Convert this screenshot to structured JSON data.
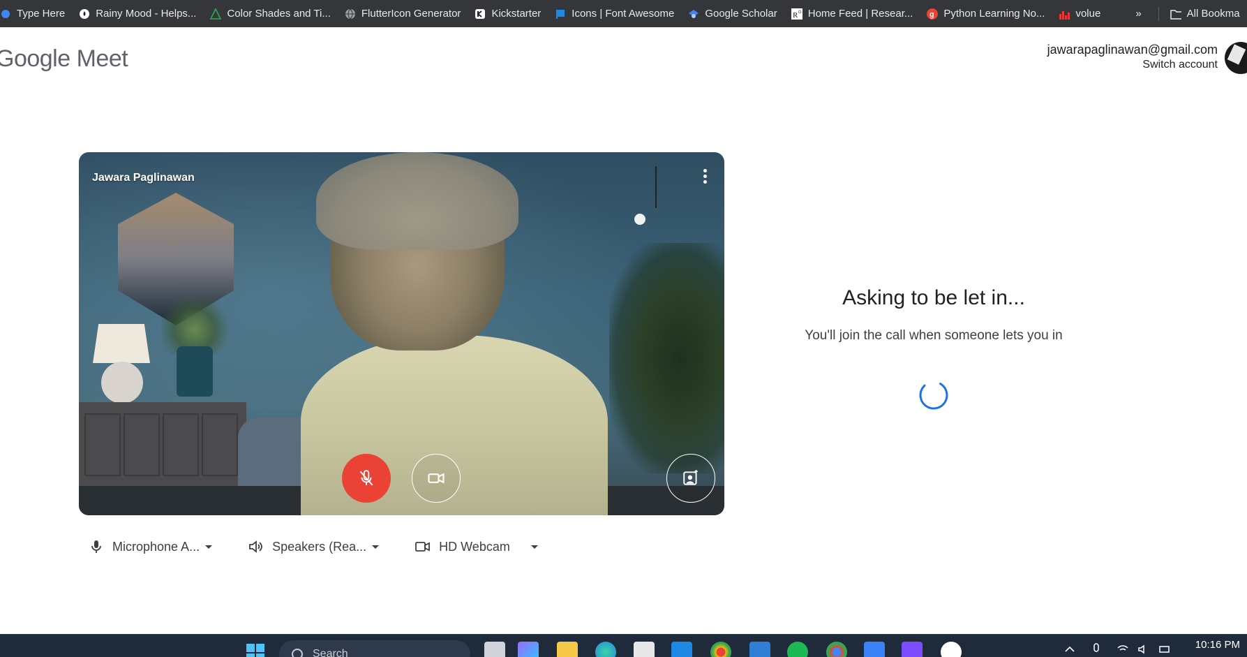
{
  "bookmarks": [
    {
      "label": "Type Here",
      "icon": "globe-icon",
      "color": "#4285f4"
    },
    {
      "label": "Rainy Mood - Helps...",
      "icon": "raindrop-icon",
      "color": "#ffffff"
    },
    {
      "label": "Color Shades and Ti...",
      "icon": "color-tint-icon",
      "color": "#34a853"
    },
    {
      "label": "FlutterIcon Generator",
      "icon": "globe-icon",
      "color": "#9aa0a6"
    },
    {
      "label": "Kickstarter",
      "icon": "kickstarter-icon",
      "color": "#ffffff"
    },
    {
      "label": "Icons | Font Awesome",
      "icon": "flag-icon",
      "color": "#1e88e5"
    },
    {
      "label": "Google Scholar",
      "icon": "scholar-icon",
      "color": "#4285f4"
    },
    {
      "label": "Home Feed | Resear...",
      "icon": "researchgate-icon",
      "color": "#ffffff"
    },
    {
      "label": "Python Learning No...",
      "icon": "g-icon",
      "color": "#ea4335"
    },
    {
      "label": "volue",
      "icon": "bar-chart-icon",
      "color": "#e53935"
    }
  ],
  "bookmarks_overflow": "»",
  "all_bookmarks": "All Bookma",
  "header": {
    "logo_google": "Google",
    "logo_meet": "Meet",
    "email": "jawarapaglinawan@gmail.com",
    "switch_account": "Switch account"
  },
  "video": {
    "participant_name": "Jawara Paglinawan"
  },
  "devices": {
    "microphone": "Microphone A...",
    "speakers": "Speakers (Rea...",
    "camera": "HD Webcam"
  },
  "status": {
    "title": "Asking to be let in...",
    "subtitle": "You'll join the call when someone lets you in"
  },
  "taskbar": {
    "search_placeholder": "Search",
    "time": "10:16 PM"
  },
  "colors": {
    "mic_off": "#ea4335",
    "spinner": "#1a73e8",
    "bookmarks_bg": "#35363a",
    "taskbar_bg": "#1f2a3a"
  }
}
